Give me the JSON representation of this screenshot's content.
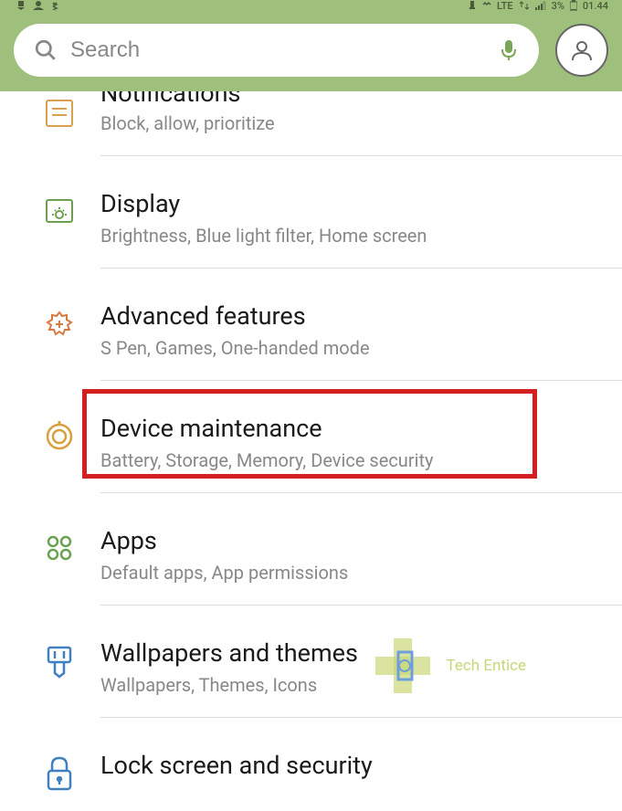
{
  "status": {
    "lte": "LTE",
    "battery": "3%",
    "time": "01.44"
  },
  "search": {
    "placeholder": "Search"
  },
  "items": [
    {
      "title": "Notifications",
      "subtitle": "Block, allow, prioritize"
    },
    {
      "title": "Display",
      "subtitle": "Brightness, Blue light filter, Home screen"
    },
    {
      "title": "Advanced features",
      "subtitle": "S Pen, Games, One-handed mode"
    },
    {
      "title": "Device maintenance",
      "subtitle": "Battery, Storage, Memory, Device security"
    },
    {
      "title": "Apps",
      "subtitle": "Default apps, App permissions"
    },
    {
      "title": "Wallpapers and themes",
      "subtitle": "Wallpapers, Themes, Icons"
    },
    {
      "title": "Lock screen and security",
      "subtitle": ""
    }
  ],
  "watermark": "Tech Entice"
}
